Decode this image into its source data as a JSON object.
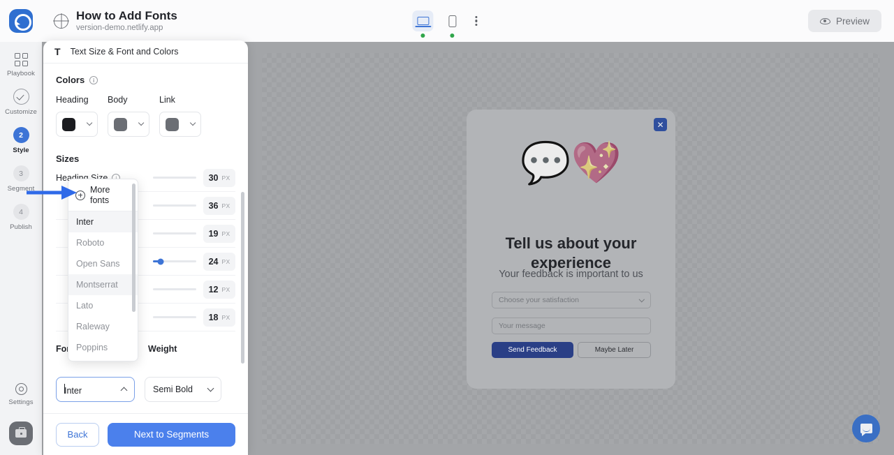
{
  "topbar": {
    "logo_icon": "app-logo",
    "site_icon": "globe-icon",
    "title": "How to Add Fonts",
    "url": "version-demo.netlify.app",
    "devices": [
      {
        "name": "desktop",
        "icon": "laptop-icon",
        "active": true,
        "status": "online"
      },
      {
        "name": "mobile",
        "icon": "phone-icon",
        "active": false,
        "status": "online"
      }
    ],
    "more_icon": "kebab-menu-icon",
    "preview_label": "Preview",
    "preview_icon": "eye-icon"
  },
  "rail": {
    "items": [
      {
        "label": "Playbook",
        "icon": "grid-icon",
        "state": "default"
      },
      {
        "label": "Customize",
        "icon": "check-circle-icon",
        "state": "done"
      },
      {
        "label": "Style",
        "step": "2",
        "state": "current"
      },
      {
        "label": "Segment",
        "step": "3",
        "state": "default"
      },
      {
        "label": "Publish",
        "step": "4",
        "state": "default"
      }
    ],
    "settings_label": "Settings",
    "settings_icon": "gear-icon",
    "avatar_icon": "briefcase-icon"
  },
  "panel": {
    "header_icon": "text-format-icon",
    "header_title": "Text Size & Font and Colors",
    "colors_label": "Colors",
    "colors": [
      {
        "name": "Heading",
        "hex": "#1b1c20"
      },
      {
        "name": "Body",
        "hex": "#6b6e74"
      },
      {
        "name": "Link",
        "hex": "#6b6e74"
      }
    ],
    "sizes_label": "Sizes",
    "sizes": [
      {
        "name": "Heading Size",
        "value": "30",
        "unit": "PX",
        "has_info": true,
        "slider_pct": 0
      },
      {
        "name": "",
        "value": "36",
        "unit": "PX",
        "has_info": false,
        "slider_pct": 0
      },
      {
        "name": "",
        "value": "19",
        "unit": "PX",
        "has_info": false,
        "slider_pct": 0
      },
      {
        "name": "",
        "value": "24",
        "unit": "PX",
        "has_info": false,
        "slider_pct": 18
      },
      {
        "name": "",
        "value": "12",
        "unit": "PX",
        "has_info": false,
        "slider_pct": 0
      },
      {
        "name": "",
        "value": "18",
        "unit": "PX",
        "has_info": false,
        "slider_pct": 0
      }
    ],
    "font_label": "Font",
    "weight_label": "Weight",
    "font_value": "Inter",
    "weight_value": "Semi Bold",
    "back_label": "Back",
    "next_label": "Next to Segments"
  },
  "font_dropdown": {
    "more_fonts_label": "More fonts",
    "more_fonts_icon": "plus-circle-icon",
    "options": [
      {
        "label": "Inter",
        "state": "selected"
      },
      {
        "label": "Roboto",
        "state": "default"
      },
      {
        "label": "Open Sans",
        "state": "default"
      },
      {
        "label": "Montserrat",
        "state": "hover"
      },
      {
        "label": "Lato",
        "state": "default"
      },
      {
        "label": "Raleway",
        "state": "default"
      },
      {
        "label": "Poppins",
        "state": "default"
      }
    ]
  },
  "preview": {
    "modal": {
      "close_icon": "close-icon",
      "emoji": "💬💖",
      "heading": "Tell us about your experience",
      "subheading": "Your feedback is important to us",
      "select_placeholder": "Choose your satisfaction",
      "select_icon": "chevron-down-icon",
      "message_placeholder": "Your message",
      "primary_button": "Send Feedback",
      "secondary_button": "Maybe Later"
    },
    "chat_launcher_icon": "chat-bubble-icon"
  },
  "annotation": {
    "arrow_color": "#2f6ae8",
    "points_to": "More fonts"
  }
}
